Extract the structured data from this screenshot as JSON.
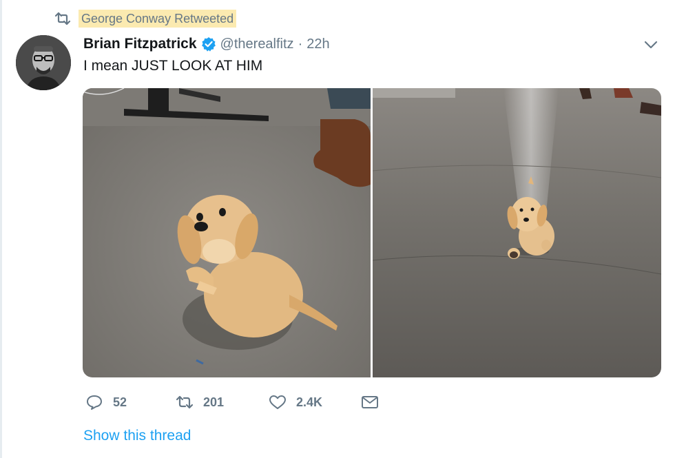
{
  "retweet_context": {
    "text": "George Conway Retweeted",
    "icon": "retweet-icon"
  },
  "tweet": {
    "author_name": "Brian Fitzpatrick",
    "verified_icon": "verified-badge-icon",
    "handle": "@therealfitz",
    "separator": "·",
    "time": "22h",
    "text": "I mean JUST LOOK AT HIM",
    "media": [
      {
        "alt": "puppy-photo-sitting"
      },
      {
        "alt": "puppy-photo-running"
      }
    ]
  },
  "actions": {
    "reply_count": "52",
    "retweet_count": "201",
    "like_count": "2.4K"
  },
  "show_thread": "Show this thread",
  "colors": {
    "accent": "#1da1f2",
    "muted": "#657786",
    "highlight": "#fbeab0",
    "text": "#14171a"
  }
}
